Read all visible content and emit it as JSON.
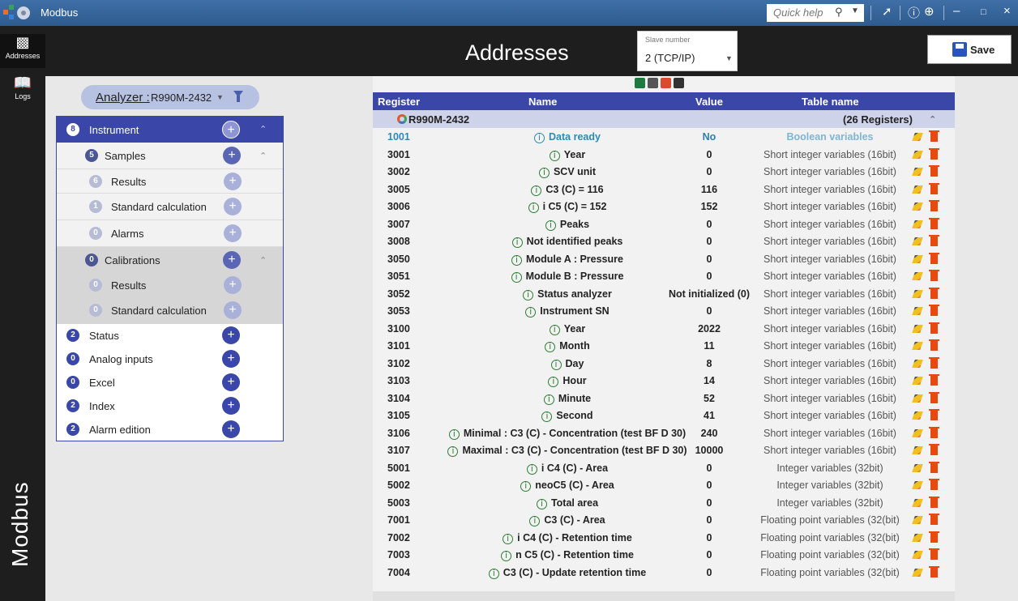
{
  "window": {
    "title": "Modbus",
    "quick_help_placeholder": "Quick help",
    "icons": [
      "search-icon",
      "dropdown-arrow-icon",
      "pin-icon",
      "info-icon",
      "chevron-circle-icon",
      "minimize-icon",
      "maximize-icon",
      "close-icon"
    ]
  },
  "nav": {
    "items": [
      {
        "label": "Addresses",
        "icon": "addresses-icon",
        "active": true
      },
      {
        "label": "Logs",
        "icon": "book-icon",
        "active": false
      }
    ],
    "brand": "Modbus"
  },
  "header": {
    "title": "Addresses",
    "slave_label": "Slave number",
    "slave_value": "2 (TCP/IP)",
    "save_label": "Save"
  },
  "analyzer": {
    "label": "Analyzer :",
    "value": "R990M-2432"
  },
  "tree": {
    "instrument": {
      "count": "8",
      "label": "Instrument"
    },
    "samples": {
      "count": "5",
      "label": "Samples"
    },
    "samples_results": {
      "count": "6",
      "label": "Results"
    },
    "samples_standard": {
      "count": "1",
      "label": "Standard calculation"
    },
    "samples_alarms": {
      "count": "0",
      "label": "Alarms"
    },
    "calibrations": {
      "count": "0",
      "label": "Calibrations"
    },
    "cal_results": {
      "count": "0",
      "label": "Results"
    },
    "cal_standard": {
      "count": "0",
      "label": "Standard calculation"
    },
    "status": {
      "count": "2",
      "label": "Status"
    },
    "analog": {
      "count": "0",
      "label": "Analog inputs"
    },
    "excel": {
      "count": "0",
      "label": "Excel"
    },
    "index": {
      "count": "2",
      "label": "Index"
    },
    "alarm_edition": {
      "count": "2",
      "label": "Alarm edition"
    }
  },
  "table": {
    "columns": {
      "register": "Register",
      "name": "Name",
      "value": "Value",
      "table_name": "Table name"
    },
    "group": {
      "name": "R990M-2432",
      "count": "(26 Registers)"
    },
    "colors": {
      "header": "#3b47a8",
      "group": "#cfd3ea",
      "boolean": "#2b8bb5"
    },
    "rows": [
      {
        "register": "1001",
        "name": "Data ready",
        "value": "No",
        "table": "Boolean variables"
      },
      {
        "register": "3001",
        "name": "Year",
        "value": "0",
        "table": "Short integer variables (16bit)"
      },
      {
        "register": "3002",
        "name": "SCV unit",
        "value": "0",
        "table": "Short integer variables (16bit)"
      },
      {
        "register": "3005",
        "name": "C3 (C) = 116",
        "value": "116",
        "table": "Short integer variables (16bit)"
      },
      {
        "register": "3006",
        "name": "i C5 (C) = 152",
        "value": "152",
        "table": "Short integer variables (16bit)"
      },
      {
        "register": "3007",
        "name": "Peaks",
        "value": "0",
        "table": "Short integer variables (16bit)"
      },
      {
        "register": "3008",
        "name": "Not identified peaks",
        "value": "0",
        "table": "Short integer variables (16bit)"
      },
      {
        "register": "3050",
        "name": "Module A : Pressure",
        "value": "0",
        "table": "Short integer variables (16bit)"
      },
      {
        "register": "3051",
        "name": "Module B : Pressure",
        "value": "0",
        "table": "Short integer variables (16bit)"
      },
      {
        "register": "3052",
        "name": "Status analyzer",
        "value": "Not initialized (0)",
        "table": "Short integer variables (16bit)"
      },
      {
        "register": "3053",
        "name": "Instrument SN",
        "value": "0",
        "table": "Short integer variables (16bit)"
      },
      {
        "register": "3100",
        "name": "Year",
        "value": "2022",
        "table": "Short integer variables (16bit)"
      },
      {
        "register": "3101",
        "name": "Month",
        "value": "11",
        "table": "Short integer variables (16bit)"
      },
      {
        "register": "3102",
        "name": "Day",
        "value": "8",
        "table": "Short integer variables (16bit)"
      },
      {
        "register": "3103",
        "name": "Hour",
        "value": "14",
        "table": "Short integer variables (16bit)"
      },
      {
        "register": "3104",
        "name": "Minute",
        "value": "52",
        "table": "Short integer variables (16bit)"
      },
      {
        "register": "3105",
        "name": "Second",
        "value": "41",
        "table": "Short integer variables (16bit)"
      },
      {
        "register": "3106",
        "name": "Minimal : C3 (C) - Concentration (test BF D 30)",
        "value": "240",
        "table": "Short integer variables (16bit)"
      },
      {
        "register": "3107",
        "name": "Maximal : C3 (C) - Concentration (test BF D 30)",
        "value": "10000",
        "table": "Short integer variables (16bit)"
      },
      {
        "register": "5001",
        "name": "i C4 (C) - Area",
        "value": "0",
        "table": "Integer variables (32bit)"
      },
      {
        "register": "5002",
        "name": "neoC5 (C) - Area",
        "value": "0",
        "table": "Integer variables (32bit)"
      },
      {
        "register": "5003",
        "name": "Total area",
        "value": "0",
        "table": "Integer variables (32bit)"
      },
      {
        "register": "7001",
        "name": "C3 (C) - Area",
        "value": "0",
        "table": "Floating point variables (32(bit)"
      },
      {
        "register": "7002",
        "name": "i C4 (C) - Retention time",
        "value": "0",
        "table": "Floating point variables (32(bit)"
      },
      {
        "register": "7003",
        "name": "n C5 (C) - Retention time",
        "value": "0",
        "table": "Floating point variables (32(bit)"
      },
      {
        "register": "7004",
        "name": "C3 (C) - Update retention time",
        "value": "0",
        "table": "Floating point variables (32(bit)"
      }
    ]
  }
}
